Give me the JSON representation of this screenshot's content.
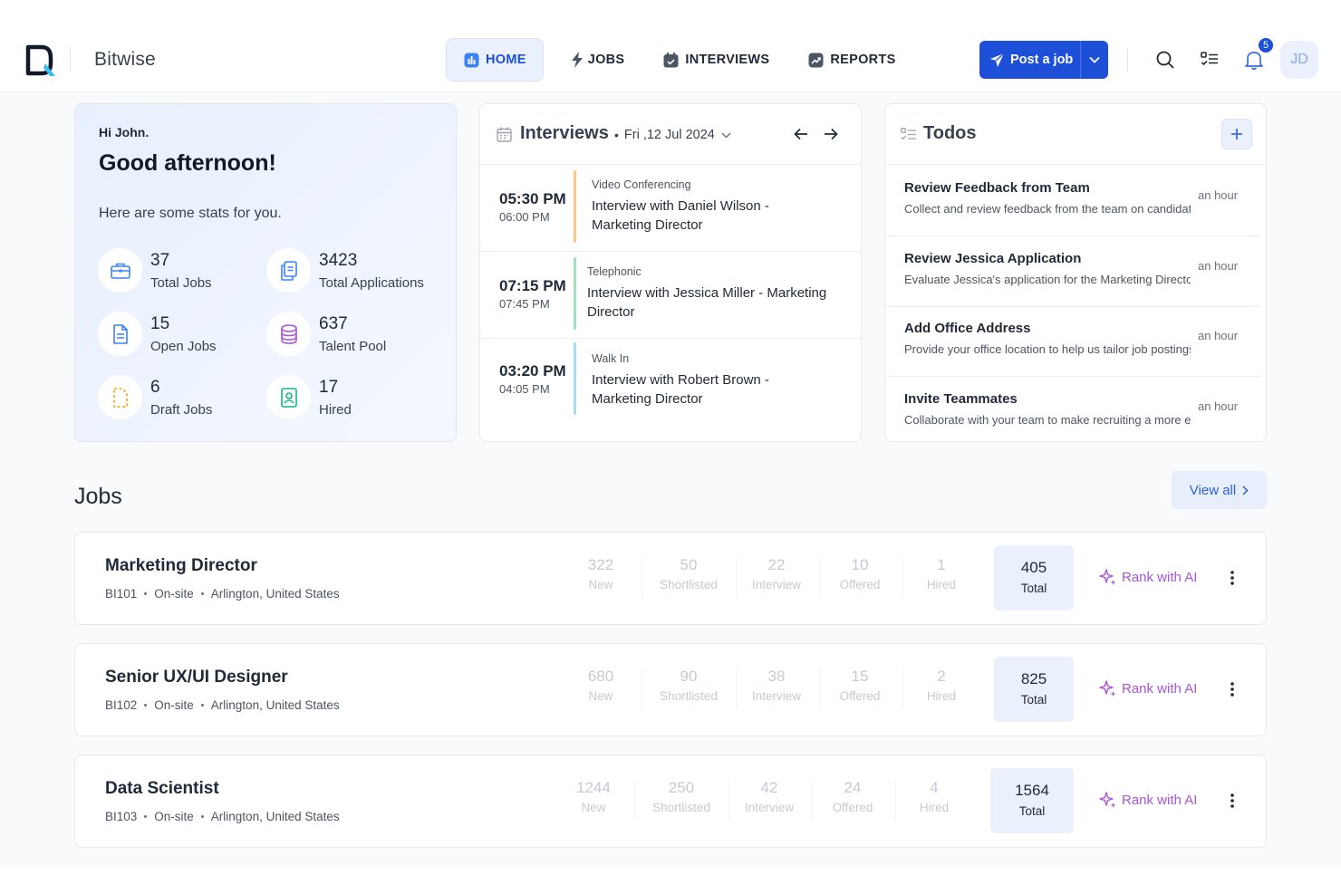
{
  "header": {
    "brand": "Bitwise",
    "nav": [
      {
        "label": "HOME",
        "icon": "chart-icon",
        "active": true
      },
      {
        "label": "JOBS",
        "icon": "bolt-icon",
        "active": false
      },
      {
        "label": "INTERVIEWS",
        "icon": "calendar-check-icon",
        "active": false
      },
      {
        "label": "REPORTS",
        "icon": "trend-icon",
        "active": false
      }
    ],
    "post_job_label": "Post a job",
    "notification_count": "5",
    "avatar_initials": "JD"
  },
  "greeting": {
    "hi": "Hi John.",
    "message": "Good afternoon!",
    "intro": "Here are some stats for you.",
    "stats": [
      {
        "value": "37",
        "label": "Total Jobs",
        "icon": "briefcase-icon"
      },
      {
        "value": "3423",
        "label": "Total Applications",
        "icon": "documents-icon"
      },
      {
        "value": "15",
        "label": "Open Jobs",
        "icon": "document-icon"
      },
      {
        "value": "637",
        "label": "Talent Pool",
        "icon": "database-icon"
      },
      {
        "value": "6",
        "label": "Draft Jobs",
        "icon": "draft-icon"
      },
      {
        "value": "17",
        "label": "Hired",
        "icon": "badge-icon"
      }
    ]
  },
  "interviews": {
    "title": "Interviews",
    "date": "Fri ,12 Jul 2024",
    "items": [
      {
        "start": "05:30 PM",
        "end": "06:00 PM",
        "type": "Video Conferencing",
        "name": "Interview with Daniel Wilson - Marketing Director",
        "color": "#f9c98a"
      },
      {
        "start": "07:15 PM",
        "end": "07:45 PM",
        "type": "Telephonic",
        "name": "Interview with Jessica Miller - Marketing Director",
        "color": "#9ee0c4"
      },
      {
        "start": "03:20 PM",
        "end": "04:05 PM",
        "type": "Walk In",
        "name": "Interview with Robert Brown - Marketing Director",
        "color": "#a8dcef"
      }
    ]
  },
  "todos": {
    "title": "Todos",
    "items": [
      {
        "title": "Review Feedback from Team",
        "desc": "Collect and review feedback from the team on candidates",
        "time": "an hour"
      },
      {
        "title": "Review Jessica Application",
        "desc": "Evaluate Jessica's application for the Marketing Director role",
        "time": "an hour"
      },
      {
        "title": "Add Office Address",
        "desc": "Provide your office location to help us tailor job postings",
        "time": "an hour"
      },
      {
        "title": "Invite Teammates",
        "desc": "Collaborate with your team to make recruiting a more efficient",
        "time": "an hour"
      }
    ]
  },
  "jobs": {
    "title": "Jobs",
    "view_all": "View all",
    "rank_label": "Rank with AI",
    "list": [
      {
        "title": "Marketing Director",
        "id": "BI101",
        "mode": "On-site",
        "location": "Arlington, United States",
        "stats": [
          {
            "v": "322",
            "l": "New"
          },
          {
            "v": "50",
            "l": "Shortlisted"
          },
          {
            "v": "22",
            "l": "Interview"
          },
          {
            "v": "10",
            "l": "Offered"
          },
          {
            "v": "1",
            "l": "Hired"
          }
        ],
        "total": "405",
        "total_label": "Total"
      },
      {
        "title": "Senior UX/UI Designer",
        "id": "BI102",
        "mode": "On-site",
        "location": "Arlington, United States",
        "stats": [
          {
            "v": "680",
            "l": "New"
          },
          {
            "v": "90",
            "l": "Shortlisted"
          },
          {
            "v": "38",
            "l": "Interview"
          },
          {
            "v": "15",
            "l": "Offered"
          },
          {
            "v": "2",
            "l": "Hired"
          }
        ],
        "total": "825",
        "total_label": "Total"
      },
      {
        "title": "Data Scientist",
        "id": "BI103",
        "mode": "On-site",
        "location": "Arlington, United States",
        "stats": [
          {
            "v": "1244",
            "l": "New"
          },
          {
            "v": "250",
            "l": "Shortlisted"
          },
          {
            "v": "42",
            "l": "Interview"
          },
          {
            "v": "24",
            "l": "Offered"
          },
          {
            "v": "4",
            "l": "Hired"
          }
        ],
        "total": "1564",
        "total_label": "Total"
      }
    ]
  },
  "colors": {
    "accent": "#1d4fd8",
    "ai": "#a855d8"
  }
}
